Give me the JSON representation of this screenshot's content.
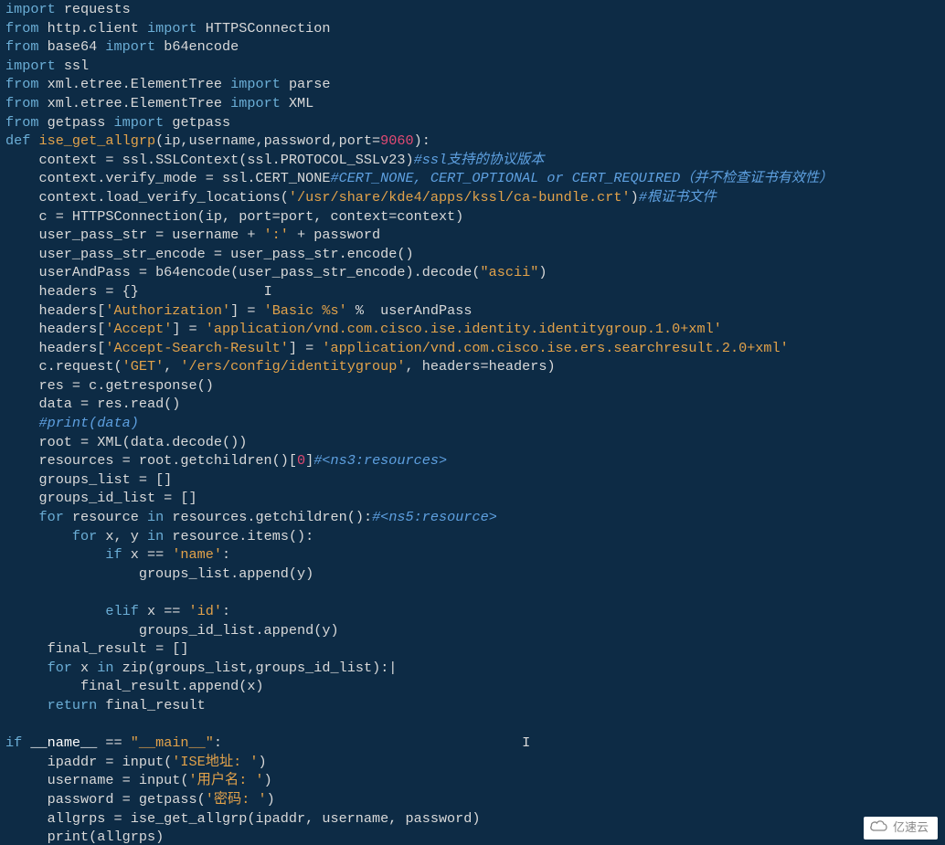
{
  "code": {
    "lines": [
      {
        "indent": 0,
        "tokens": [
          {
            "t": "kw",
            "v": "import"
          },
          {
            "t": "sp"
          },
          {
            "t": "name",
            "v": "requests"
          }
        ]
      },
      {
        "indent": 0,
        "tokens": [
          {
            "t": "kw",
            "v": "from"
          },
          {
            "t": "sp"
          },
          {
            "t": "name",
            "v": "http.client"
          },
          {
            "t": "sp"
          },
          {
            "t": "kw",
            "v": "import"
          },
          {
            "t": "sp"
          },
          {
            "t": "name",
            "v": "HTTPSConnection"
          }
        ]
      },
      {
        "indent": 0,
        "tokens": [
          {
            "t": "kw",
            "v": "from"
          },
          {
            "t": "sp"
          },
          {
            "t": "name",
            "v": "base64"
          },
          {
            "t": "sp"
          },
          {
            "t": "kw",
            "v": "import"
          },
          {
            "t": "sp"
          },
          {
            "t": "name",
            "v": "b64encode"
          }
        ]
      },
      {
        "indent": 0,
        "tokens": [
          {
            "t": "kw",
            "v": "import"
          },
          {
            "t": "sp"
          },
          {
            "t": "name",
            "v": "ssl"
          }
        ]
      },
      {
        "indent": 0,
        "tokens": [
          {
            "t": "kw",
            "v": "from"
          },
          {
            "t": "sp"
          },
          {
            "t": "name",
            "v": "xml.etree.ElementTree"
          },
          {
            "t": "sp"
          },
          {
            "t": "kw",
            "v": "import"
          },
          {
            "t": "sp"
          },
          {
            "t": "name",
            "v": "parse"
          }
        ]
      },
      {
        "indent": 0,
        "tokens": [
          {
            "t": "kw",
            "v": "from"
          },
          {
            "t": "sp"
          },
          {
            "t": "name",
            "v": "xml.etree.ElementTree"
          },
          {
            "t": "sp"
          },
          {
            "t": "kw",
            "v": "import"
          },
          {
            "t": "sp"
          },
          {
            "t": "name",
            "v": "XML"
          }
        ]
      },
      {
        "indent": 0,
        "tokens": [
          {
            "t": "kw",
            "v": "from"
          },
          {
            "t": "sp"
          },
          {
            "t": "name",
            "v": "getpass"
          },
          {
            "t": "sp"
          },
          {
            "t": "kw",
            "v": "import"
          },
          {
            "t": "sp"
          },
          {
            "t": "name",
            "v": "getpass"
          }
        ]
      },
      {
        "indent": 0,
        "tokens": [
          {
            "t": "kw",
            "v": "def"
          },
          {
            "t": "sp"
          },
          {
            "t": "yel",
            "v": "ise_get_allgrp"
          },
          {
            "t": "paren",
            "v": "("
          },
          {
            "t": "name",
            "v": "ip,username,password,port="
          },
          {
            "t": "num",
            "v": "9060"
          },
          {
            "t": "paren",
            "v": "):"
          }
        ]
      },
      {
        "indent": 1,
        "tokens": [
          {
            "t": "name",
            "v": "context = ssl.SSLContext(ssl.PROTOCOL_SSLv23)"
          },
          {
            "t": "cmt",
            "v": "#ssl支持的协议版本"
          }
        ]
      },
      {
        "indent": 1,
        "tokens": [
          {
            "t": "name",
            "v": "context.verify_mode = ssl.CERT_NONE"
          },
          {
            "t": "cmt",
            "v": "#CERT_NONE, CERT_OPTIONAL or CERT_REQUIRED（并不检查证书有效性）"
          }
        ]
      },
      {
        "indent": 1,
        "tokens": [
          {
            "t": "name",
            "v": "context.load_verify_locations("
          },
          {
            "t": "str",
            "v": "'/usr/share/kde4/apps/kssl/ca-bundle.crt'"
          },
          {
            "t": "name",
            "v": ")"
          },
          {
            "t": "cmt",
            "v": "#根证书文件"
          }
        ]
      },
      {
        "indent": 1,
        "tokens": [
          {
            "t": "name",
            "v": "c = HTTPSConnection(ip, port=port, context=context)"
          }
        ]
      },
      {
        "indent": 1,
        "tokens": [
          {
            "t": "name",
            "v": "user_pass_str = username + "
          },
          {
            "t": "str",
            "v": "':'"
          },
          {
            "t": "name",
            "v": " + password"
          }
        ]
      },
      {
        "indent": 1,
        "tokens": [
          {
            "t": "name",
            "v": "user_pass_str_encode = user_pass_str.encode()"
          }
        ]
      },
      {
        "indent": 1,
        "tokens": [
          {
            "t": "name",
            "v": "userAndPass = b64encode(user_pass_str_encode).decode("
          },
          {
            "t": "str",
            "v": "\"ascii\""
          },
          {
            "t": "name",
            "v": ")"
          }
        ]
      },
      {
        "indent": 1,
        "tokens": [
          {
            "t": "name",
            "v": "headers = {}"
          },
          {
            "t": "caret",
            "pad": "               "
          }
        ]
      },
      {
        "indent": 1,
        "tokens": [
          {
            "t": "name",
            "v": "headers["
          },
          {
            "t": "str",
            "v": "'Authorization'"
          },
          {
            "t": "name",
            "v": "] = "
          },
          {
            "t": "str",
            "v": "'Basic %s'"
          },
          {
            "t": "name",
            "v": " %  userAndPass"
          }
        ]
      },
      {
        "indent": 1,
        "tokens": [
          {
            "t": "name",
            "v": "headers["
          },
          {
            "t": "str",
            "v": "'Accept'"
          },
          {
            "t": "name",
            "v": "] = "
          },
          {
            "t": "str",
            "v": "'application/vnd.com.cisco.ise.identity.identitygroup.1.0+xml'"
          }
        ]
      },
      {
        "indent": 1,
        "tokens": [
          {
            "t": "name",
            "v": "headers["
          },
          {
            "t": "str",
            "v": "'Accept-Search-Result'"
          },
          {
            "t": "name",
            "v": "] = "
          },
          {
            "t": "str",
            "v": "'application/vnd.com.cisco.ise.ers.searchresult.2.0+xml'"
          }
        ]
      },
      {
        "indent": 1,
        "tokens": [
          {
            "t": "name",
            "v": "c.request("
          },
          {
            "t": "str",
            "v": "'GET'"
          },
          {
            "t": "name",
            "v": ", "
          },
          {
            "t": "str",
            "v": "'/ers/config/identitygroup'"
          },
          {
            "t": "name",
            "v": ", headers=headers)"
          }
        ]
      },
      {
        "indent": 1,
        "tokens": [
          {
            "t": "name",
            "v": "res = c.getresponse()"
          }
        ]
      },
      {
        "indent": 1,
        "tokens": [
          {
            "t": "name",
            "v": "data = res.read()"
          }
        ]
      },
      {
        "indent": 1,
        "tokens": [
          {
            "t": "cmt",
            "v": "#print(data)"
          }
        ]
      },
      {
        "indent": 1,
        "tokens": [
          {
            "t": "name",
            "v": "root = XML(data.decode())"
          }
        ]
      },
      {
        "indent": 1,
        "tokens": [
          {
            "t": "name",
            "v": "resources = root.getchildren()["
          },
          {
            "t": "num",
            "v": "0"
          },
          {
            "t": "name",
            "v": "]"
          },
          {
            "t": "cmt",
            "v": "#<ns3:resources>"
          }
        ]
      },
      {
        "indent": 1,
        "tokens": [
          {
            "t": "name",
            "v": "groups_list = []"
          }
        ]
      },
      {
        "indent": 1,
        "tokens": [
          {
            "t": "name",
            "v": "groups_id_list = []"
          }
        ]
      },
      {
        "indent": 1,
        "tokens": [
          {
            "t": "kw",
            "v": "for"
          },
          {
            "t": "sp"
          },
          {
            "t": "name",
            "v": "resource"
          },
          {
            "t": "sp"
          },
          {
            "t": "kw",
            "v": "in"
          },
          {
            "t": "sp"
          },
          {
            "t": "name",
            "v": "resources.getchildren():"
          },
          {
            "t": "cmt",
            "v": "#<ns5:resource>"
          }
        ]
      },
      {
        "indent": 2,
        "tokens": [
          {
            "t": "kw",
            "v": "for"
          },
          {
            "t": "sp"
          },
          {
            "t": "name",
            "v": "x, y"
          },
          {
            "t": "sp"
          },
          {
            "t": "kw",
            "v": "in"
          },
          {
            "t": "sp"
          },
          {
            "t": "name",
            "v": "resource.items():"
          }
        ]
      },
      {
        "indent": 3,
        "tokens": [
          {
            "t": "kw",
            "v": "if"
          },
          {
            "t": "sp"
          },
          {
            "t": "name",
            "v": "x == "
          },
          {
            "t": "str",
            "v": "'name'"
          },
          {
            "t": "name",
            "v": ":"
          }
        ]
      },
      {
        "indent": 4,
        "tokens": [
          {
            "t": "name",
            "v": "groups_list.append(y)"
          }
        ]
      },
      {
        "indent": 4,
        "tokens": []
      },
      {
        "indent": 3,
        "tokens": [
          {
            "t": "kw",
            "v": "elif"
          },
          {
            "t": "sp"
          },
          {
            "t": "name",
            "v": "x == "
          },
          {
            "t": "str",
            "v": "'id'"
          },
          {
            "t": "name",
            "v": ":"
          }
        ]
      },
      {
        "indent": 4,
        "tokens": [
          {
            "t": "name",
            "v": "groups_id_list.append(y)"
          }
        ]
      },
      {
        "indent": 1,
        "tokens": [
          {
            "t": "name",
            "v": " final_result = []"
          }
        ]
      },
      {
        "indent": 1,
        "tokens": [
          {
            "t": "sp"
          },
          {
            "t": "kw",
            "v": "for"
          },
          {
            "t": "sp"
          },
          {
            "t": "name",
            "v": "x"
          },
          {
            "t": "sp"
          },
          {
            "t": "kw",
            "v": "in"
          },
          {
            "t": "sp"
          },
          {
            "t": "name",
            "v": "zip(groups_list,groups_id_list):|"
          }
        ]
      },
      {
        "indent": 2,
        "tokens": [
          {
            "t": "name",
            "v": " final_result.append(x)"
          }
        ]
      },
      {
        "indent": 1,
        "tokens": [
          {
            "t": "sp"
          },
          {
            "t": "kw",
            "v": "return"
          },
          {
            "t": "sp"
          },
          {
            "t": "name",
            "v": "final_result"
          }
        ]
      },
      {
        "indent": 0,
        "tokens": []
      },
      {
        "indent": 0,
        "tokens": [
          {
            "t": "kw",
            "v": "if"
          },
          {
            "t": "sp"
          },
          {
            "t": "white",
            "v": "__name__"
          },
          {
            "t": "name",
            "v": " == "
          },
          {
            "t": "str",
            "v": "\"__main__\""
          },
          {
            "t": "name",
            "v": ":"
          },
          {
            "t": "caret",
            "pad": "                                    "
          }
        ]
      },
      {
        "indent": 1,
        "tokens": [
          {
            "t": "name",
            "v": " ipaddr = input("
          },
          {
            "t": "str",
            "v": "'ISE地址: '"
          },
          {
            "t": "name",
            "v": ")"
          }
        ]
      },
      {
        "indent": 1,
        "tokens": [
          {
            "t": "name",
            "v": " username = input("
          },
          {
            "t": "str",
            "v": "'用户名: '"
          },
          {
            "t": "name",
            "v": ")"
          }
        ]
      },
      {
        "indent": 1,
        "tokens": [
          {
            "t": "name",
            "v": " password = getpass("
          },
          {
            "t": "str",
            "v": "'密码: '"
          },
          {
            "t": "name",
            "v": ")"
          }
        ]
      },
      {
        "indent": 1,
        "tokens": [
          {
            "t": "name",
            "v": " allgrps = ise_get_allgrp(ipaddr, username, password)"
          }
        ]
      },
      {
        "indent": 1,
        "tokens": [
          {
            "t": "name",
            "v": " print(allgrps)"
          }
        ]
      }
    ]
  },
  "watermark": "亿速云"
}
